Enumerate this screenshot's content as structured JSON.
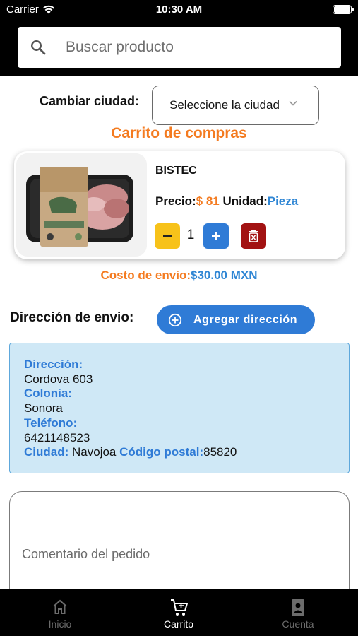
{
  "status_bar": {
    "carrier": "Carrier",
    "time": "10:30 AM"
  },
  "search": {
    "placeholder": "Buscar producto"
  },
  "city": {
    "label": "Cambiar ciudad:",
    "select_placeholder": "Seleccione la ciudad"
  },
  "cart": {
    "title": "Carrito de compras",
    "items": [
      {
        "name": "BISTEC",
        "image_brand_text": "Kowi",
        "price_label": "Precio:",
        "price_value": "$ 81",
        "unit_label": "Unidad:",
        "unit_value": "Pieza",
        "quantity": "1"
      }
    ]
  },
  "shipping": {
    "label": "Costo de envio:",
    "value": "$30.00 MXN"
  },
  "address": {
    "section_label": "Dirección de envio:",
    "add_button": "Agregar dirección",
    "direccion_label": "Dirección:",
    "direccion_value": "Cordova 603",
    "colonia_label": "Colonia:",
    "colonia_value": "Sonora",
    "telefono_label": "Teléfono:",
    "telefono_value": "6421148523",
    "ciudad_label": "Ciudad:",
    "ciudad_value": "Navojoa",
    "cp_label": "Código postal:",
    "cp_value": "85820"
  },
  "comment": {
    "placeholder": "Comentario del pedido"
  },
  "tabbar": {
    "items": [
      {
        "label": "Inicio",
        "icon": "home-icon",
        "active": false
      },
      {
        "label": "Carrito",
        "icon": "cart-icon",
        "active": true
      },
      {
        "label": "Cuenta",
        "icon": "account-icon",
        "active": false
      }
    ]
  },
  "colors": {
    "accent_orange": "#f47b20",
    "accent_blue": "#2f7bd6",
    "delete_red": "#a21212",
    "minus_yellow": "#f7c21a",
    "address_bg": "#cfe8f6"
  }
}
